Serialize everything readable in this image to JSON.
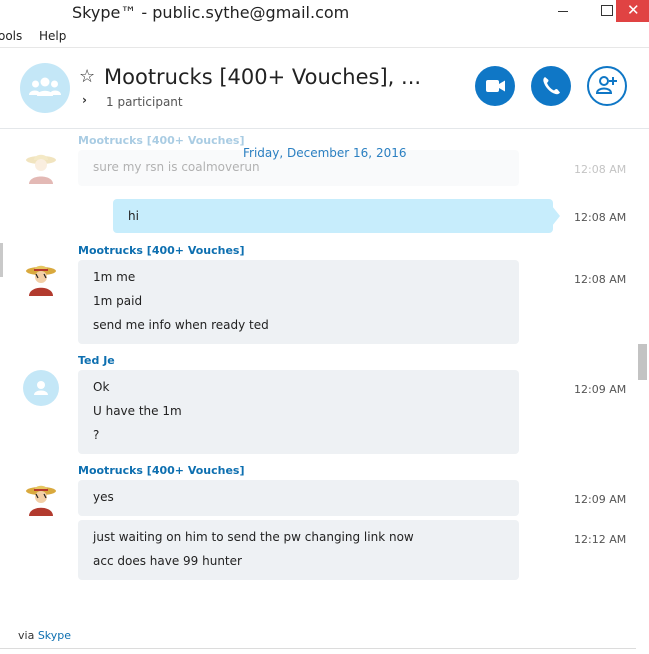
{
  "window": {
    "title": "Skype™ - public.sythe@gmail.com",
    "close_glyph": "✕"
  },
  "menu": {
    "items": [
      "Tools",
      "Help"
    ],
    "tools_label": "ools",
    "help_label": "Help"
  },
  "conversation": {
    "title": "Mootrucks [400+ Vouches], ...",
    "participants": "1 participant",
    "star_icon": "☆",
    "expand_icon": "›"
  },
  "colors": {
    "accent": "#0f77c6",
    "outgoing_bubble": "#c7edfc",
    "incoming_bubble": "#eef1f4",
    "sender_name": "#0d6fb0"
  },
  "chat": {
    "date_separator": "Friday, December 16, 2016",
    "messages": [
      {
        "sender": "Mootrucks [400+ Vouches]",
        "lines": [
          "sure my rsn is coalmoverun"
        ],
        "time": "12:08 AM",
        "faded": true
      },
      {
        "sender": "",
        "outgoing": true,
        "lines": [
          "hi"
        ],
        "time": "12:08 AM"
      },
      {
        "sender": "Mootrucks [400+ Vouches]",
        "lines": [
          "1m me",
          "1m paid",
          "send me info when ready ted"
        ],
        "time": "12:08 AM"
      },
      {
        "sender": "Ted Je",
        "lines": [
          "Ok",
          "U have the 1m",
          "?"
        ],
        "time": "12:09 AM"
      },
      {
        "sender": "Mootrucks [400+ Vouches]",
        "lines": [
          "yes"
        ],
        "time": "12:09 AM"
      },
      {
        "sender": "",
        "lines": [
          "just waiting on him to send the pw changing link now",
          "acc does have 99 hunter"
        ],
        "time": "12:12 AM"
      }
    ]
  },
  "footer": {
    "via": "via",
    "link": "Skype"
  }
}
